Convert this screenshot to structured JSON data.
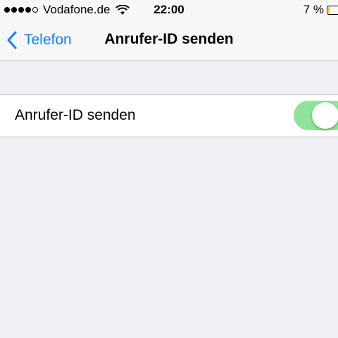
{
  "status_bar": {
    "signal_bars_filled": 4,
    "signal_bars_total": 5,
    "carrier": "Vodafone.de",
    "wifi_icon": "wifi-icon",
    "time": "22:00",
    "battery_percent": "7 %",
    "battery_level": 0.07,
    "battery_color": "#f5c400"
  },
  "nav": {
    "back_label": "Telefon",
    "title": "Anrufer-ID senden",
    "accent_color": "#157efb"
  },
  "settings": {
    "row_label": "Anrufer-ID senden",
    "toggle_on": true,
    "toggle_color": "#8fe49b"
  }
}
